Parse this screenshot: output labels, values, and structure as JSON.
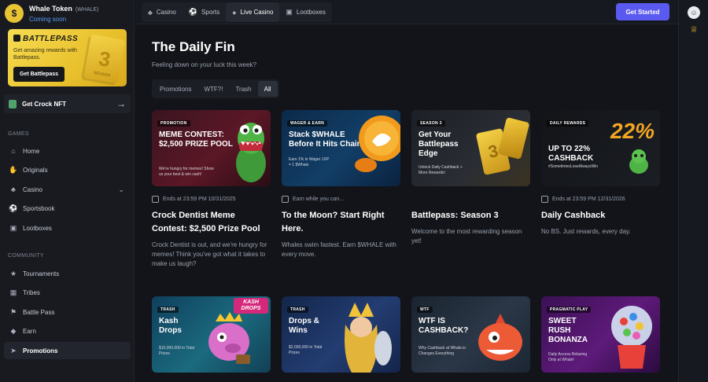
{
  "brand": {
    "logo_icon": "whale-coin-icon",
    "name": "Whale Token",
    "ticker": "(WHALE)",
    "status": "Coming soon"
  },
  "battlepass_promo": {
    "title": "BATTLEPASS",
    "description": "Get amazing rewards with Battlepass.",
    "button": "Get Battlepass",
    "ticket_number": "3",
    "ticket_word": "SEASON"
  },
  "nft": {
    "label": "Get Crock NFT",
    "icon": "arrow-right-icon"
  },
  "sidebar": {
    "games_label": "GAMES",
    "games": [
      {
        "label": "Home",
        "icon": "home-icon"
      },
      {
        "label": "Originals",
        "icon": "originals-icon"
      },
      {
        "label": "Casino",
        "icon": "casino-icon"
      },
      {
        "label": "Sportsbook",
        "icon": "sportsbook-icon"
      },
      {
        "label": "Lootboxes",
        "icon": "lootbox-icon"
      }
    ],
    "community_label": "COMMUNITY",
    "community": [
      {
        "label": "Tournaments",
        "icon": "trophy-icon"
      },
      {
        "label": "Tribes",
        "icon": "tribes-icon"
      },
      {
        "label": "Battle Pass",
        "icon": "battle-pass-icon"
      },
      {
        "label": "Earn",
        "icon": "earn-icon"
      },
      {
        "label": "Promotions",
        "icon": "megaphone-icon"
      }
    ]
  },
  "topbar": {
    "tabs": [
      {
        "label": "Casino",
        "icon": "casino-icon"
      },
      {
        "label": "Sports",
        "icon": "sports-icon"
      },
      {
        "label": "Live Casino",
        "icon": "live-casino-icon"
      },
      {
        "label": "Lootboxes",
        "icon": "lootbox-icon"
      }
    ],
    "cta": "Get Started"
  },
  "rail": {
    "icons": [
      "avatar-icon",
      "trophy-icon"
    ]
  },
  "page": {
    "title": "The Daily Fin",
    "subtitle": "Feeling down on your luck this week?",
    "filters": [
      "Promotions",
      "WTF?!",
      "Trash",
      "All"
    ],
    "active_filter": "All"
  },
  "cards": [
    {
      "tag": "PROMOTION",
      "headline": "MEME CONTEST: $2,500 PRIZE POOL",
      "small": "We're hungry for memes! Show us your best & win cash!",
      "meta": "Ends at 23:59 PM 10/31/2025",
      "title": "Crock Dentist Meme Contest: $2,500 Prize Pool",
      "desc": "Crock Dentist is out, and we're hungry for memes! Think you've got what it takes to make us laugh?"
    },
    {
      "tag": "WAGER & EARN",
      "headline": "Stack $WHALE Before It Hits Chain",
      "small": "Earn 1% in Wager 1XP = 1 $Whale",
      "meta": "Earn while you can...",
      "title": "To the Moon? Start Right Here.",
      "desc": "Whales swim fastest. Earn $WHALE with every move."
    },
    {
      "tag": "SEASON 3",
      "headline": "Get Your Battlepass Edge",
      "small": "Unlock Daily Cashback + More Rewards!",
      "meta": "",
      "title": "Battlepass: Season 3",
      "desc": "Welcome to the most rewarding season yet!"
    },
    {
      "tag": "DAILY REWARDS",
      "headline": "UP TO 22% CASHBACK",
      "small": "#SometimesLoseAlwaysWin",
      "big": "22%",
      "meta": "Ends at 23:59 PM 12/31/2026",
      "title": "Daily Cashback",
      "desc": "No BS. Just rewards, every day."
    },
    {
      "tag": "TRASH",
      "headline": "Kash Drops",
      "small": "$10,000,000 in Total Prizes",
      "logo": "KASH DROPS"
    },
    {
      "tag": "TRASH",
      "headline": "Drops & Wins",
      "small": "$2,000,000 in Total Prizes"
    },
    {
      "tag": "WTF",
      "headline": "WTF IS CASHBACK?",
      "small": "Why Cashback at Whale.io Changes Everything"
    },
    {
      "tag": "PRAGMATIC PLAY",
      "headline": "SWEET RUSH BONANZA",
      "small": "Daily Access Relaxing Only at Whale!"
    }
  ],
  "colors": {
    "accent": "#5a59f0",
    "brand_yellow": "#e8c435",
    "background": "#121419"
  }
}
